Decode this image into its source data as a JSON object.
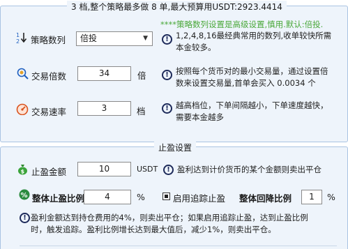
{
  "strategy_panel": {
    "title": "3 档,整个策略最多做 8 单,最大预算用USDT:2923.4414",
    "rows": {
      "count": {
        "label": "策略数列",
        "value": "倍投",
        "note": "****策略数列设置是高级设置,慎用.默认:倍投.",
        "desc_line1": "1,2,4,8,16最经典常用的数列,收单较快所需",
        "desc_line2": "本金较多。"
      },
      "multiplier": {
        "label": "交易倍数",
        "value": "34",
        "unit": "倍",
        "desc_line1": "按照每个货币对的最小交易量，通过设置倍",
        "desc_line2": "数来设置交易量,首单会买入 0.0034 个"
      },
      "speed": {
        "label": "交易速率",
        "value": "3",
        "unit": "档",
        "desc_line1": "越高档位，下单间隔越小，下单速度越快，",
        "desc_line2": "需要本金越多"
      }
    }
  },
  "tp_panel": {
    "title": "止盈设置",
    "amount": {
      "label": "止盈金额",
      "value": "10",
      "unit": "USDT",
      "desc": "盈利达到计价货币的某个金额则卖出平仓"
    },
    "ratio": {
      "label": "整体止盈比例",
      "value": "4",
      "unit": "%"
    },
    "trailing": {
      "label": "启用追踪止盈",
      "checked": true
    },
    "callback": {
      "label": "整体回降比例",
      "value": "1",
      "unit": "%"
    },
    "note_line1": "盈利金额达到持仓费用的4%，则卖出平仓；如果启用追踪止盈，达到止盈比例",
    "note_line2": "时，触发追踪。盈利比例增长达到最大值后，减少1%，则卖出平仓。"
  },
  "icons": {
    "order": "sort-order-icon",
    "search": "magnifier-coin-icon",
    "speed": "speedometer-icon",
    "money": "money-bag-icon",
    "percent": "percent-icon",
    "info": "info-circle-icon"
  },
  "colors": {
    "panel_bg": "#eef4fb",
    "panel_border": "#a9c3e2",
    "note_green": "#4aa83a"
  }
}
